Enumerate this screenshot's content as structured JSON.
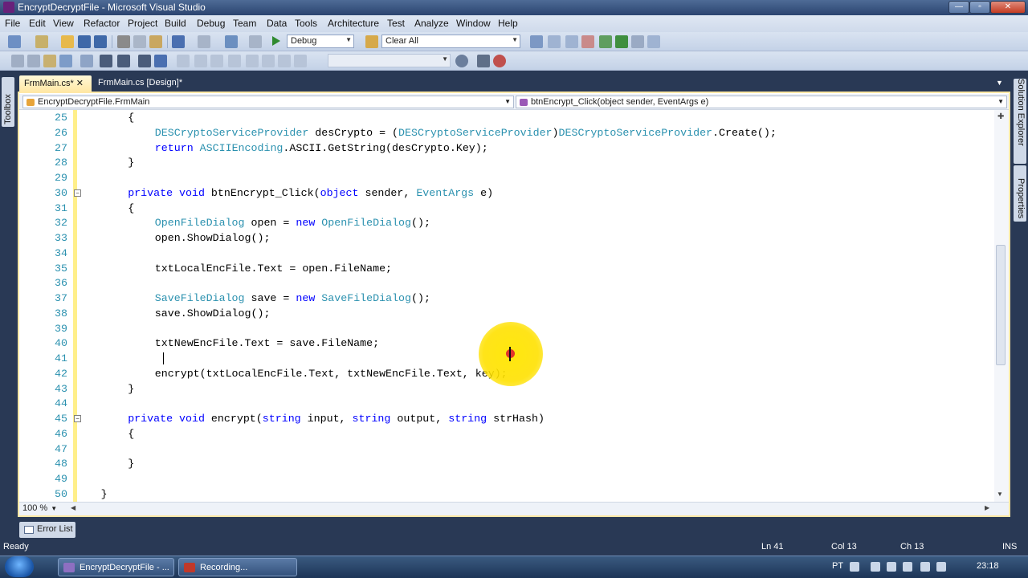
{
  "window": {
    "title": "EncryptDecryptFile - Microsoft Visual Studio"
  },
  "menu": [
    "File",
    "Edit",
    "View",
    "Refactor",
    "Project",
    "Build",
    "Debug",
    "Team",
    "Data",
    "Tools",
    "Architecture",
    "Test",
    "Analyze",
    "Window",
    "Help"
  ],
  "toolbar": {
    "config_value": "Debug",
    "find_value": "Clear All"
  },
  "left_panel": {
    "toolbox_label": "Toolbox"
  },
  "right_panel": {
    "solution_explorer_label": "Solution Explorer",
    "properties_label": "Properties"
  },
  "tabs": [
    {
      "label": "FrmMain.cs*",
      "active": true
    },
    {
      "label": "FrmMain.cs [Design]*",
      "active": false
    }
  ],
  "navigation": {
    "type_value": "EncryptDecryptFile.FrmMain",
    "member_value": "btnEncrypt_Click(object sender, EventArgs e)"
  },
  "code_lines": [
    {
      "num": "25",
      "indent": 2,
      "tokens": [
        {
          "t": "{",
          "c": "tx"
        }
      ]
    },
    {
      "num": "26",
      "indent": 3,
      "tokens": [
        {
          "t": "DESCryptoServiceProvider",
          "c": "ty"
        },
        {
          "t": " desCrypto = (",
          "c": "tx"
        },
        {
          "t": "DESCryptoServiceProvider",
          "c": "ty"
        },
        {
          "t": ")",
          "c": "tx"
        },
        {
          "t": "DESCryptoServiceProvider",
          "c": "ty"
        },
        {
          "t": ".Create();",
          "c": "tx"
        }
      ]
    },
    {
      "num": "27",
      "indent": 3,
      "tokens": [
        {
          "t": "return",
          "c": "kw"
        },
        {
          "t": " ",
          "c": "tx"
        },
        {
          "t": "ASCIIEncoding",
          "c": "ty"
        },
        {
          "t": ".ASCII.GetString(desCrypto.Key);",
          "c": "tx"
        }
      ]
    },
    {
      "num": "28",
      "indent": 2,
      "tokens": [
        {
          "t": "}",
          "c": "tx"
        }
      ]
    },
    {
      "num": "29",
      "indent": 0,
      "tokens": []
    },
    {
      "num": "30",
      "indent": 2,
      "outline": true,
      "tokens": [
        {
          "t": "private",
          "c": "kw"
        },
        {
          "t": " ",
          "c": "tx"
        },
        {
          "t": "void",
          "c": "kw"
        },
        {
          "t": " btnEncrypt_Click(",
          "c": "tx"
        },
        {
          "t": "object",
          "c": "kw"
        },
        {
          "t": " sender, ",
          "c": "tx"
        },
        {
          "t": "EventArgs",
          "c": "ty"
        },
        {
          "t": " e)",
          "c": "tx"
        }
      ]
    },
    {
      "num": "31",
      "indent": 2,
      "tokens": [
        {
          "t": "{",
          "c": "tx"
        }
      ]
    },
    {
      "num": "32",
      "indent": 3,
      "tokens": [
        {
          "t": "OpenFileDialog",
          "c": "ty"
        },
        {
          "t": " open = ",
          "c": "tx"
        },
        {
          "t": "new",
          "c": "kw"
        },
        {
          "t": " ",
          "c": "tx"
        },
        {
          "t": "OpenFileDialog",
          "c": "ty"
        },
        {
          "t": "();",
          "c": "tx"
        }
      ]
    },
    {
      "num": "33",
      "indent": 3,
      "tokens": [
        {
          "t": "open.ShowDialog();",
          "c": "tx"
        }
      ]
    },
    {
      "num": "34",
      "indent": 0,
      "tokens": []
    },
    {
      "num": "35",
      "indent": 3,
      "tokens": [
        {
          "t": "txtLocalEncFile.Text = open.FileName;",
          "c": "tx"
        }
      ]
    },
    {
      "num": "36",
      "indent": 0,
      "tokens": []
    },
    {
      "num": "37",
      "indent": 3,
      "tokens": [
        {
          "t": "SaveFileDialog",
          "c": "ty"
        },
        {
          "t": " save = ",
          "c": "tx"
        },
        {
          "t": "new",
          "c": "kw"
        },
        {
          "t": " ",
          "c": "tx"
        },
        {
          "t": "SaveFileDialog",
          "c": "ty"
        },
        {
          "t": "();",
          "c": "tx"
        }
      ]
    },
    {
      "num": "38",
      "indent": 3,
      "tokens": [
        {
          "t": "save.ShowDialog();",
          "c": "tx"
        }
      ]
    },
    {
      "num": "39",
      "indent": 0,
      "tokens": []
    },
    {
      "num": "40",
      "indent": 3,
      "tokens": [
        {
          "t": "txtNewEncFile.Text = save.FileName;",
          "c": "tx"
        }
      ]
    },
    {
      "num": "41",
      "indent": 0,
      "tokens": []
    },
    {
      "num": "42",
      "indent": 3,
      "tokens": [
        {
          "t": "encrypt(txtLocalEncFile.Text, txtNewEncFile.Text, key);",
          "c": "tx"
        }
      ]
    },
    {
      "num": "43",
      "indent": 2,
      "tokens": [
        {
          "t": "}",
          "c": "tx"
        }
      ]
    },
    {
      "num": "44",
      "indent": 0,
      "tokens": []
    },
    {
      "num": "45",
      "indent": 2,
      "outline": true,
      "tokens": [
        {
          "t": "private",
          "c": "kw"
        },
        {
          "t": " ",
          "c": "tx"
        },
        {
          "t": "void",
          "c": "kw"
        },
        {
          "t": " encrypt(",
          "c": "tx"
        },
        {
          "t": "string",
          "c": "kw"
        },
        {
          "t": " input, ",
          "c": "tx"
        },
        {
          "t": "string",
          "c": "kw"
        },
        {
          "t": " output, ",
          "c": "tx"
        },
        {
          "t": "string",
          "c": "kw"
        },
        {
          "t": " strHash)",
          "c": "tx"
        }
      ]
    },
    {
      "num": "46",
      "indent": 2,
      "tokens": [
        {
          "t": "{",
          "c": "tx"
        }
      ]
    },
    {
      "num": "47",
      "indent": 0,
      "tokens": []
    },
    {
      "num": "48",
      "indent": 2,
      "tokens": [
        {
          "t": "}",
          "c": "tx"
        }
      ]
    },
    {
      "num": "49",
      "indent": 0,
      "tokens": []
    },
    {
      "num": "50",
      "indent": 1,
      "tokens": [
        {
          "t": "}",
          "c": "tx"
        }
      ]
    }
  ],
  "editor": {
    "zoom": "100 %"
  },
  "panels": {
    "error_list": "Error List"
  },
  "status": {
    "state": "Ready",
    "line": "Ln 41",
    "col": "Col 13",
    "ch": "Ch 13",
    "mode": "INS"
  },
  "taskbar": {
    "items": [
      "EncryptDecryptFile - ...",
      "Recording..."
    ],
    "lang": "PT",
    "clock": "23:18"
  },
  "colors": {
    "keyword": "#0000ff",
    "type": "#2b91af",
    "line_number": "#2b91af",
    "active_tab": "#ffe8a6",
    "chrome": "#293955"
  }
}
